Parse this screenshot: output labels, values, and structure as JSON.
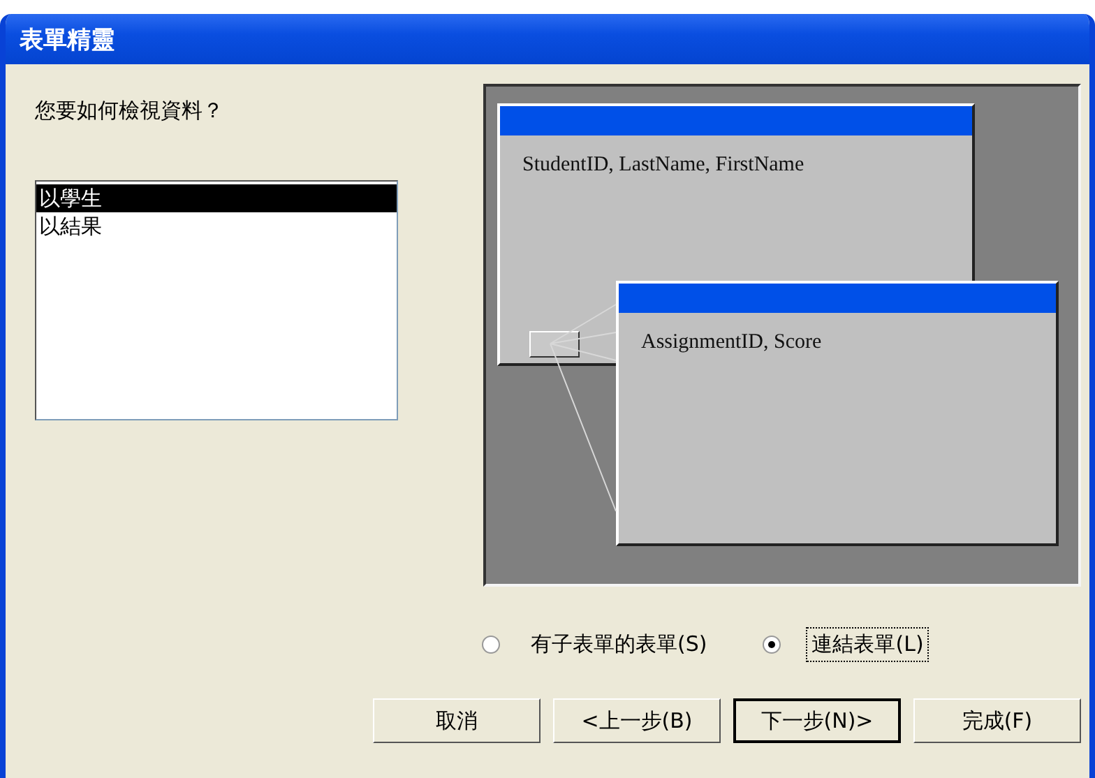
{
  "window": {
    "title": "表單精靈"
  },
  "question": "您要如何檢視資料？",
  "view_options": [
    {
      "label": "以學生",
      "selected": true
    },
    {
      "label": "以結果",
      "selected": false
    }
  ],
  "preview": {
    "main_form": {
      "fields": "StudentID, LastName, FirstName"
    },
    "sub_form": {
      "fields": "AssignmentID, Score"
    }
  },
  "layout_options": [
    {
      "label": "有子表單的表單(S)",
      "selected": false
    },
    {
      "label": "連結表單(L)",
      "selected": true
    }
  ],
  "buttons": [
    {
      "label": "取消",
      "default": false
    },
    {
      "label": "<上一步(B)",
      "default": false
    },
    {
      "label": "下一步(N)>",
      "default": true
    },
    {
      "label": "完成(F)",
      "default": false
    }
  ]
}
